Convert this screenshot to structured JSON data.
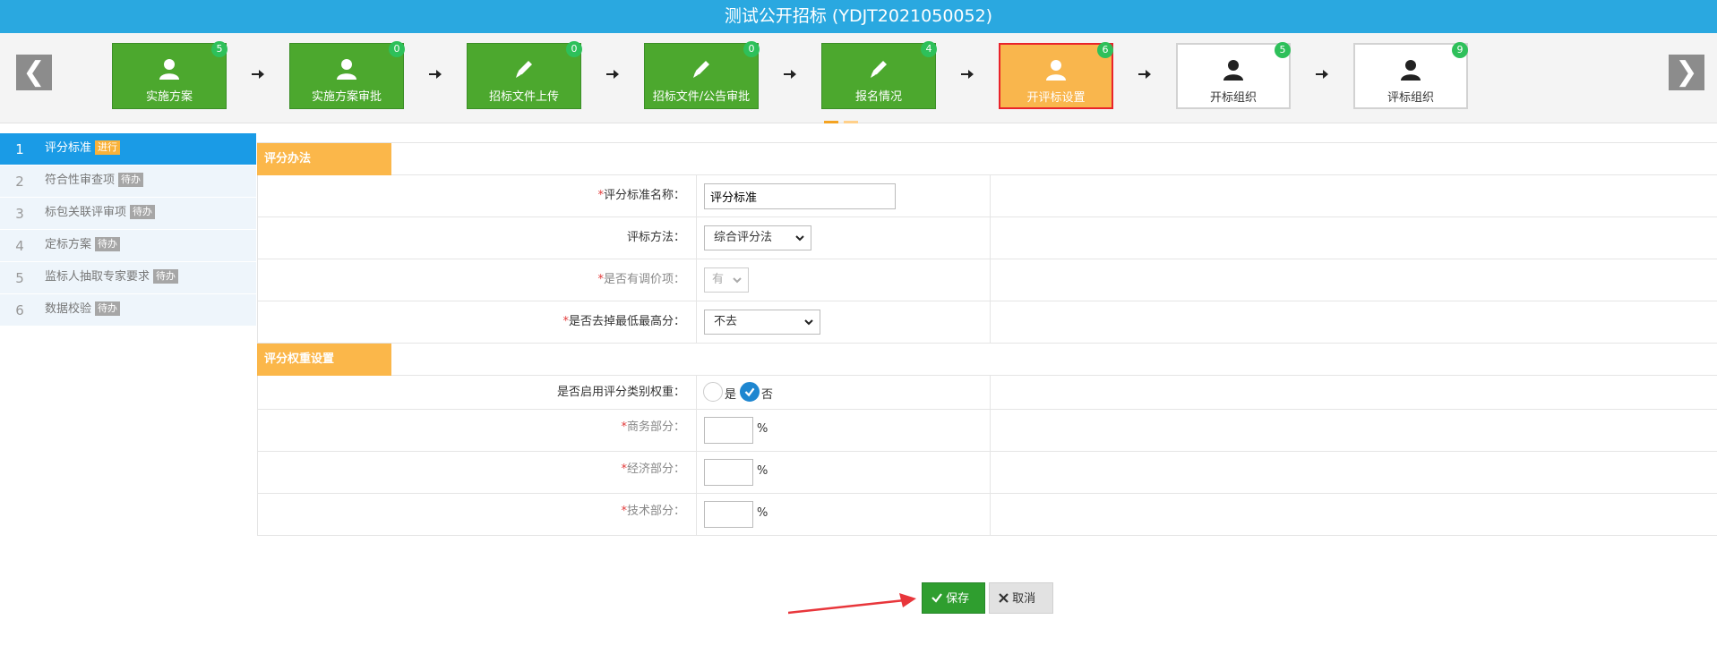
{
  "title": "测试公开招标 (YDJT2021050052)",
  "nav": {
    "prev": "❮",
    "next": "❯"
  },
  "steps": [
    {
      "label": "实施方案",
      "badge": "5",
      "icon": "user-icon",
      "state": "done"
    },
    {
      "label": "实施方案审批",
      "badge": "0",
      "icon": "user-icon",
      "state": "done"
    },
    {
      "label": "招标文件上传",
      "badge": "0",
      "icon": "pencil-icon",
      "state": "done"
    },
    {
      "label": "招标文件/公告审批",
      "badge": "0",
      "icon": "pencil-icon",
      "state": "done"
    },
    {
      "label": "报名情况",
      "badge": "4",
      "icon": "pencil-icon",
      "state": "done"
    },
    {
      "label": "开评标设置",
      "badge": "6",
      "icon": "user-icon",
      "state": "active"
    },
    {
      "label": "开标组织",
      "badge": "5",
      "icon": "user-icon",
      "state": "inactive"
    },
    {
      "label": "评标组织",
      "badge": "9",
      "icon": "user-icon",
      "state": "inactive"
    }
  ],
  "sidebar": {
    "items": [
      {
        "num": "1",
        "label": "评分标准",
        "tag": "进行"
      },
      {
        "num": "2",
        "label": "符合性审查项",
        "tag": "待办"
      },
      {
        "num": "3",
        "label": "标包关联评审项",
        "tag": "待办"
      },
      {
        "num": "4",
        "label": "定标方案",
        "tag": "待办"
      },
      {
        "num": "5",
        "label": "监标人抽取专家要求",
        "tag": "待办"
      },
      {
        "num": "6",
        "label": "数据校验",
        "tag": "待办"
      }
    ]
  },
  "form": {
    "section1": "评分办法",
    "name_label": "评分标准名称：",
    "name_value": "评分标准",
    "method_label": "评标方法：",
    "method_value": "综合评分法",
    "adjust_label": "是否有调价项：",
    "adjust_value": "有",
    "remove_label": "是否去掉最低最高分：",
    "remove_value": "不去",
    "section2": "评分权重设置",
    "enable_label": "是否启用评分类别权重：",
    "yes": "是",
    "no": "否",
    "business_label": "商务部分：",
    "economy_label": "经济部分：",
    "tech_label": "技术部分：",
    "percent": "%",
    "required": "*"
  },
  "buttons": {
    "save": "保存",
    "cancel": "取消"
  },
  "colors": {
    "title_bg": "#2aa8e0",
    "step_done": "#4ca82e",
    "step_active": "#f9b64d",
    "section": "#fbb74a"
  }
}
